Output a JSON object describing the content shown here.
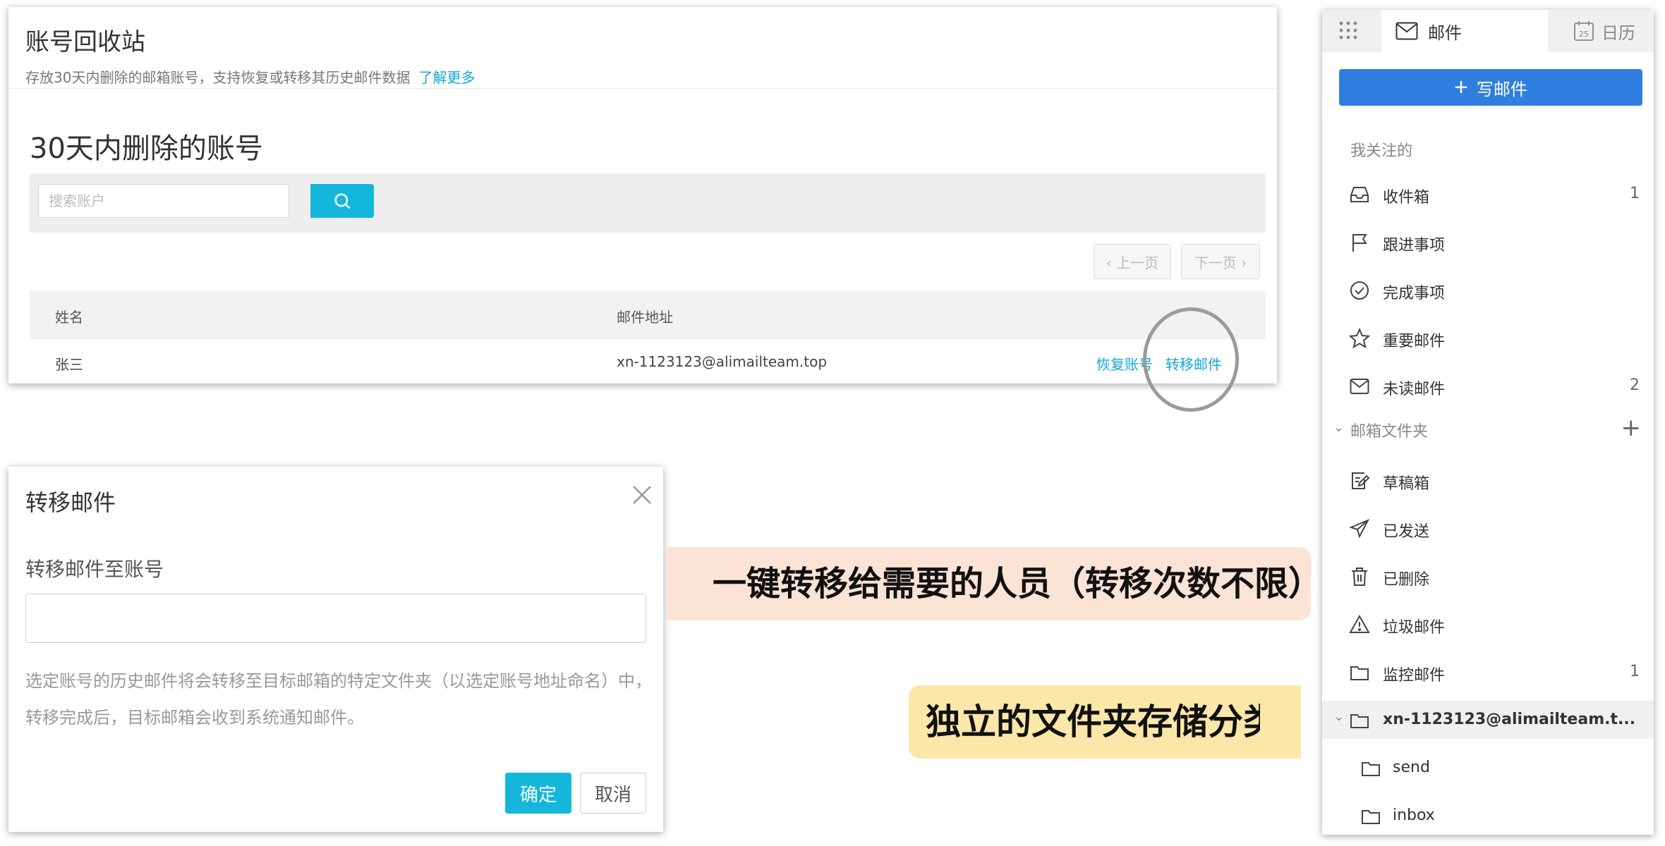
{
  "recycle": {
    "title": "账号回收站",
    "description": "存放30天内删除的邮箱账号，支持恢复或转移其历史邮件数据",
    "learn_more": "了解更多",
    "subtitle": "30天内删除的账号",
    "search_placeholder": "搜索账户",
    "prev_page": "‹ 上一页",
    "next_page": "下一页 ›",
    "columns": {
      "name": "姓名",
      "email": "邮件地址"
    },
    "rows": [
      {
        "name": "张三",
        "email": "xn-1123123@alimailteam.top",
        "restore": "恢复账号",
        "transfer": "转移邮件"
      }
    ]
  },
  "transfer_dialog": {
    "title": "转移邮件",
    "label": "转移邮件至账号",
    "input_value": "",
    "hint_line1": "选定账号的历史邮件将会转移至目标邮箱的特定文件夹（以选定账号地址命名）中，",
    "hint_line2": "转移完成后，目标邮箱会收到系统通知邮件。",
    "confirm": "确定",
    "cancel": "取消"
  },
  "callouts": {
    "transfer_note": "一键转移给需要的人员（转移次数不限）",
    "folder_note": "独立的文件夹存储分类"
  },
  "sidebar": {
    "tab_mail": "邮件",
    "tab_calendar": "日历",
    "calendar_day": "25",
    "compose": "写邮件",
    "section_followed": "我关注的",
    "followed": [
      {
        "label": "收件箱",
        "count": "1",
        "icon": "inbox-icon"
      },
      {
        "label": "跟进事项",
        "count": "",
        "icon": "flag-icon"
      },
      {
        "label": "完成事项",
        "count": "",
        "icon": "check-circle-icon"
      },
      {
        "label": "重要邮件",
        "count": "",
        "icon": "star-icon"
      },
      {
        "label": "未读邮件",
        "count": "2",
        "icon": "envelope-icon"
      }
    ],
    "section_folders": "邮箱文件夹",
    "folders": [
      {
        "label": "草稿箱",
        "count": "",
        "icon": "draft-icon"
      },
      {
        "label": "已发送",
        "count": "",
        "icon": "send-icon"
      },
      {
        "label": "已删除",
        "count": "",
        "icon": "trash-icon"
      },
      {
        "label": "垃圾邮件",
        "count": "",
        "icon": "warning-icon"
      },
      {
        "label": "监控邮件",
        "count": "1",
        "icon": "folder-icon"
      }
    ],
    "transferred_folder": "xn-1123123@alimailteam.t...",
    "subfolders": [
      {
        "label": "send"
      },
      {
        "label": "inbox"
      }
    ]
  },
  "colors": {
    "accent": "#14b7d9",
    "compose": "#2f7fe0",
    "callout_pink": "#fbe3d6",
    "callout_yellow": "#fbe7a8"
  }
}
